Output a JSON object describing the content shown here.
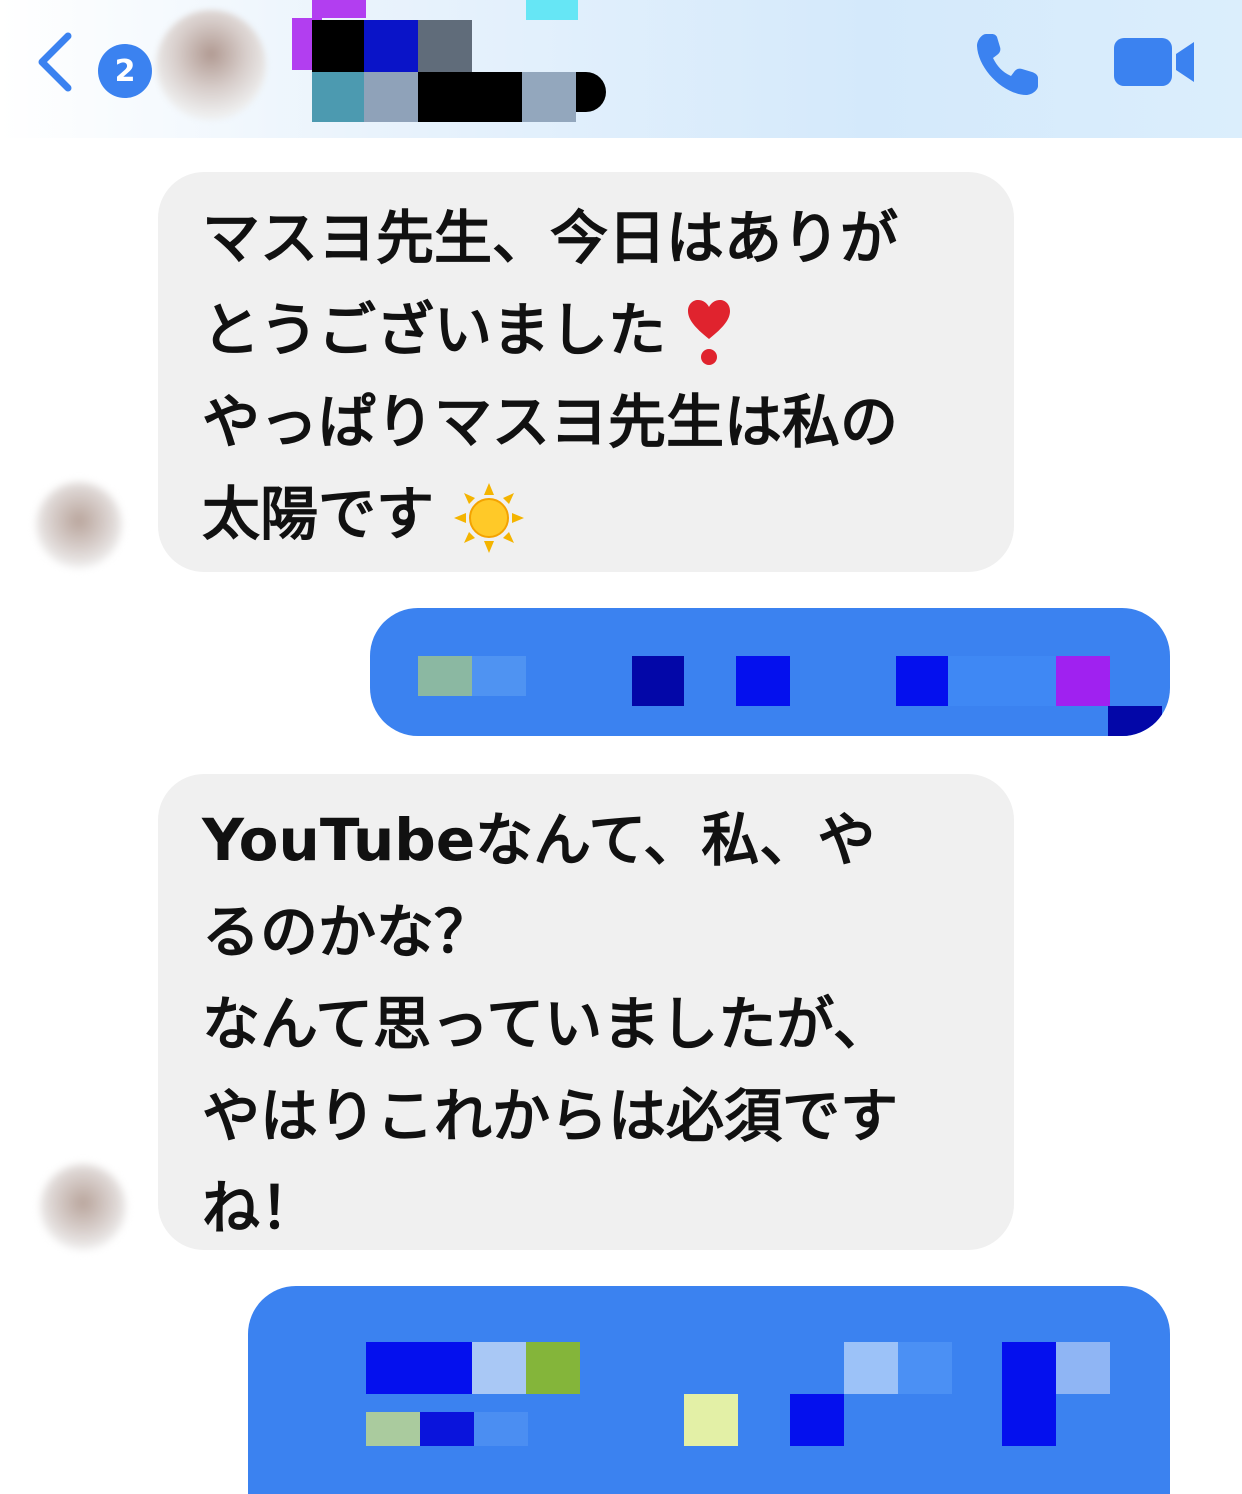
{
  "header": {
    "back_label": "",
    "unread_count": "2",
    "contact_name": "",
    "call_icon": "phone-icon",
    "video_icon": "video-camera-icon"
  },
  "messages": [
    {
      "direction": "incoming",
      "lines": [
        "マスヨ先生、今日はありが",
        "とうございました",
        "やっぱりマスヨ先生は私の",
        "太陽です"
      ],
      "emojis": [
        "heart-exclamation-icon",
        "sun-icon"
      ]
    },
    {
      "direction": "outgoing",
      "redacted": true
    },
    {
      "direction": "incoming",
      "lines": [
        "YouTubeなんて、私、や",
        "るのかな？",
        "なんて思っていましたが、",
        "やはりこれからは必須です",
        "ね！"
      ]
    },
    {
      "direction": "outgoing",
      "redacted": true
    }
  ],
  "colors": {
    "accent": "#3b82f0",
    "incoming_bubble": "#f0f0f0",
    "text": "#111111"
  }
}
